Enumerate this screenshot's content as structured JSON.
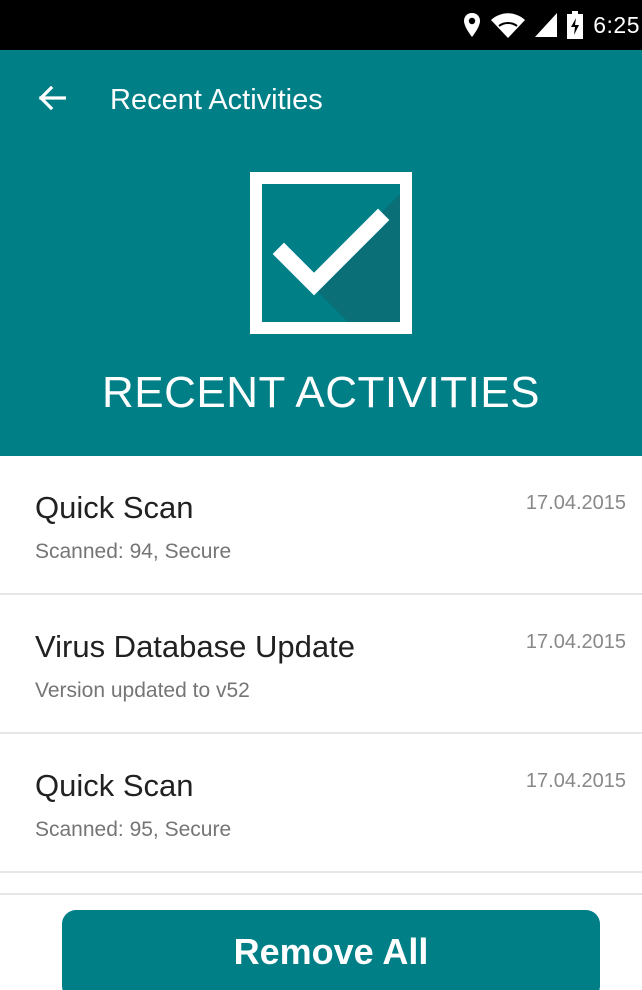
{
  "status_bar": {
    "time": "6:25",
    "icons": [
      "location-icon",
      "wifi-icon",
      "signal-icon",
      "battery-charging-icon"
    ]
  },
  "app_bar": {
    "back_icon": "arrow-left-icon",
    "title": "Recent Activities"
  },
  "hero": {
    "icon": "checkbox-checked-icon",
    "title": "RECENT ACTIVITIES"
  },
  "activities": [
    {
      "title": "Quick Scan",
      "subtitle": "Scanned: 94, Secure",
      "date": "17.04.2015"
    },
    {
      "title": "Virus Database Update",
      "subtitle": "Version updated to v52",
      "date": "17.04.2015"
    },
    {
      "title": "Quick Scan",
      "subtitle": "Scanned: 95, Secure",
      "date": "17.04.2015"
    }
  ],
  "actions": {
    "remove_all_label": "Remove All"
  },
  "colors": {
    "primary": "#007f87",
    "status_bar": "#000000",
    "text_primary": "#212121",
    "text_secondary": "#757575",
    "divider": "#e6e6e6"
  }
}
